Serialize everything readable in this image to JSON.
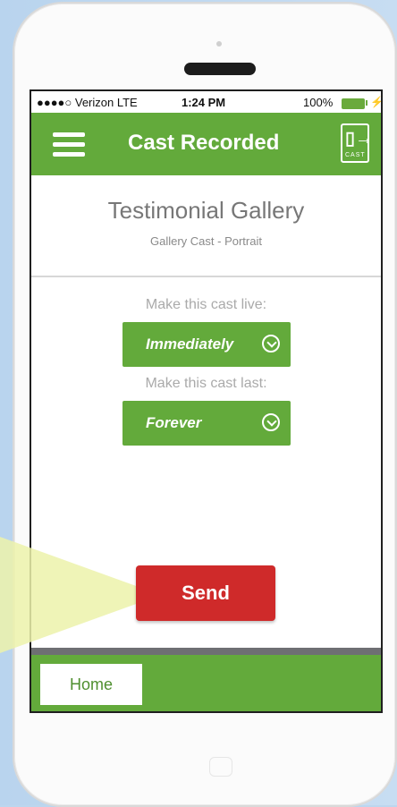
{
  "status_bar": {
    "carrier": "●●●●○ Verizon  LTE",
    "time": "1:24 PM",
    "battery": "100%"
  },
  "nav": {
    "title": "Cast Recorded",
    "logo_glyph": "▯→",
    "logo_text": "CAST"
  },
  "gallery": {
    "title": "Testimonial Gallery",
    "subtitle": "Gallery Cast - Portrait"
  },
  "cast_live": {
    "label": "Make this cast live:",
    "value": "Immediately"
  },
  "cast_last": {
    "label": "Make this cast last:",
    "value": "Forever"
  },
  "send_label": "Send",
  "footer": {
    "home_label": "Home"
  },
  "colors": {
    "accent_green": "#63aa3b",
    "send_red": "#cf2a2a"
  },
  "icons": [
    "menu-icon",
    "cast-logo-icon",
    "chevron-down-icon",
    "battery-icon"
  ]
}
